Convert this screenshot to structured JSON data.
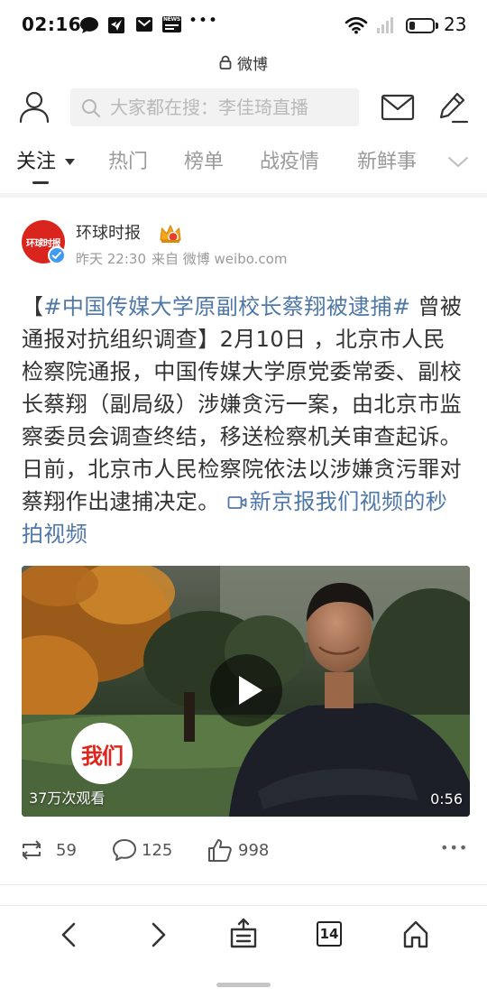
{
  "status_bar": {
    "time": "02:16",
    "notification_icons": [
      "chat-icon",
      "bird-app-icon",
      "mail-icon",
      "news-icon"
    ],
    "news_icon_text": "NEWS",
    "more_notifications": "•••",
    "system_icons": [
      "wifi-icon",
      "signal-icon",
      "battery-icon"
    ],
    "battery_level": 0.23,
    "battery_text": "23"
  },
  "browser": {
    "title": "微博",
    "secure_icon": "lock-icon"
  },
  "header": {
    "left_icon": "profile-icon",
    "search_icon": "search-icon",
    "search_placeholder": "大家都在搜：李佳琦直播",
    "right_icons": [
      "mail-icon",
      "compose-icon"
    ]
  },
  "tabs": [
    {
      "label": "关注",
      "active": true,
      "has_dropdown": true
    },
    {
      "label": "热门",
      "active": false
    },
    {
      "label": "榜单",
      "active": false
    },
    {
      "label": "战疫情",
      "active": false
    },
    {
      "label": "新鲜事",
      "active": false
    }
  ],
  "post": {
    "author": "环球时报",
    "avatar_logo_text": "环球时报",
    "verified": true,
    "member_icon": "crown-icon",
    "time": "昨天 22:30",
    "source": "来自 微博 weibo.com",
    "text": [
      {
        "type": "text",
        "text": "【"
      },
      {
        "type": "hashtag",
        "text": "#中国传媒大学原副校长蔡翔被逮捕#"
      },
      {
        "type": "text",
        "text": " 曾被通报对抗组织调查】2月10日 ，北京市人民检察院通报，中国传媒大学原党委常委、副校长蔡翔（副局级）涉嫌贪污一案，由北京市监察委员会调查终结，移送检察机关审查起诉。日前，北京市人民检察院依法以涉嫌贪污罪对蔡翔作出逮捕决定。"
      },
      {
        "type": "video-link",
        "text": "新京报我们视频的秒拍视频"
      }
    ],
    "video": {
      "views": "37万次观看",
      "duration": "0:56",
      "logo_text": "我们",
      "play_icon": "play-icon"
    },
    "actions": {
      "reposts": "59",
      "comments": "125",
      "likes": "998",
      "more": "•••"
    }
  },
  "bottom_nav": {
    "icons": [
      "back-icon",
      "forward-icon",
      "share-icon",
      "tabs-icon",
      "home-icon"
    ],
    "tab_count": "14"
  },
  "colors": {
    "text": "#333333",
    "muted": "#999999",
    "link": "#4f78a8",
    "verified": "#3f9bf2",
    "avatar_red": "#d9251d",
    "crown": "#f3a71c"
  }
}
